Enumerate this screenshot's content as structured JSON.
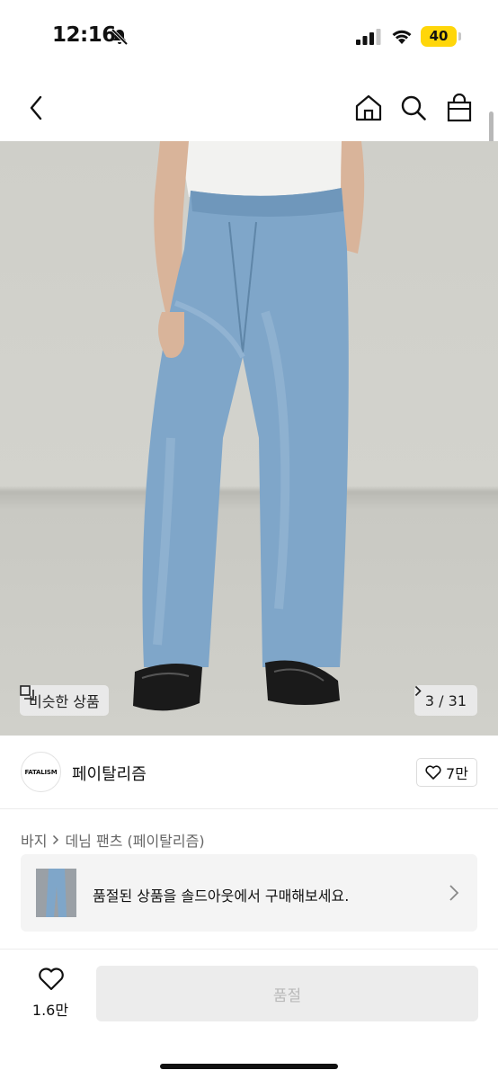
{
  "status_bar": {
    "time": "12:16",
    "battery": "40",
    "icons": [
      "bell-slash-icon",
      "signal-icon",
      "wifi-icon",
      "battery-icon"
    ]
  },
  "nav": {
    "back_icon": "chevron-left-icon",
    "home_icon": "home-icon",
    "search_icon": "search-icon",
    "cart_icon": "shopping-bag-icon"
  },
  "hero": {
    "similar_label": "비슷한 상품",
    "page_indicator": "3 / 31"
  },
  "shop": {
    "logo_text": "FATALISM",
    "name": "페이탈리즘",
    "like_count": "7만"
  },
  "breadcrumb": {
    "category": "바지",
    "subcategory": "데님 팬츠 (페이탈리즘)"
  },
  "banner": {
    "text": "품절된 상품을 솔드아웃에서 구매해보세요."
  },
  "bottom": {
    "heart_count": "1.6만",
    "buy_label": "품절"
  },
  "colors": {
    "battery": "#ffd60a",
    "denim": "#7fa6c9",
    "disabled_button": "#ececec"
  }
}
